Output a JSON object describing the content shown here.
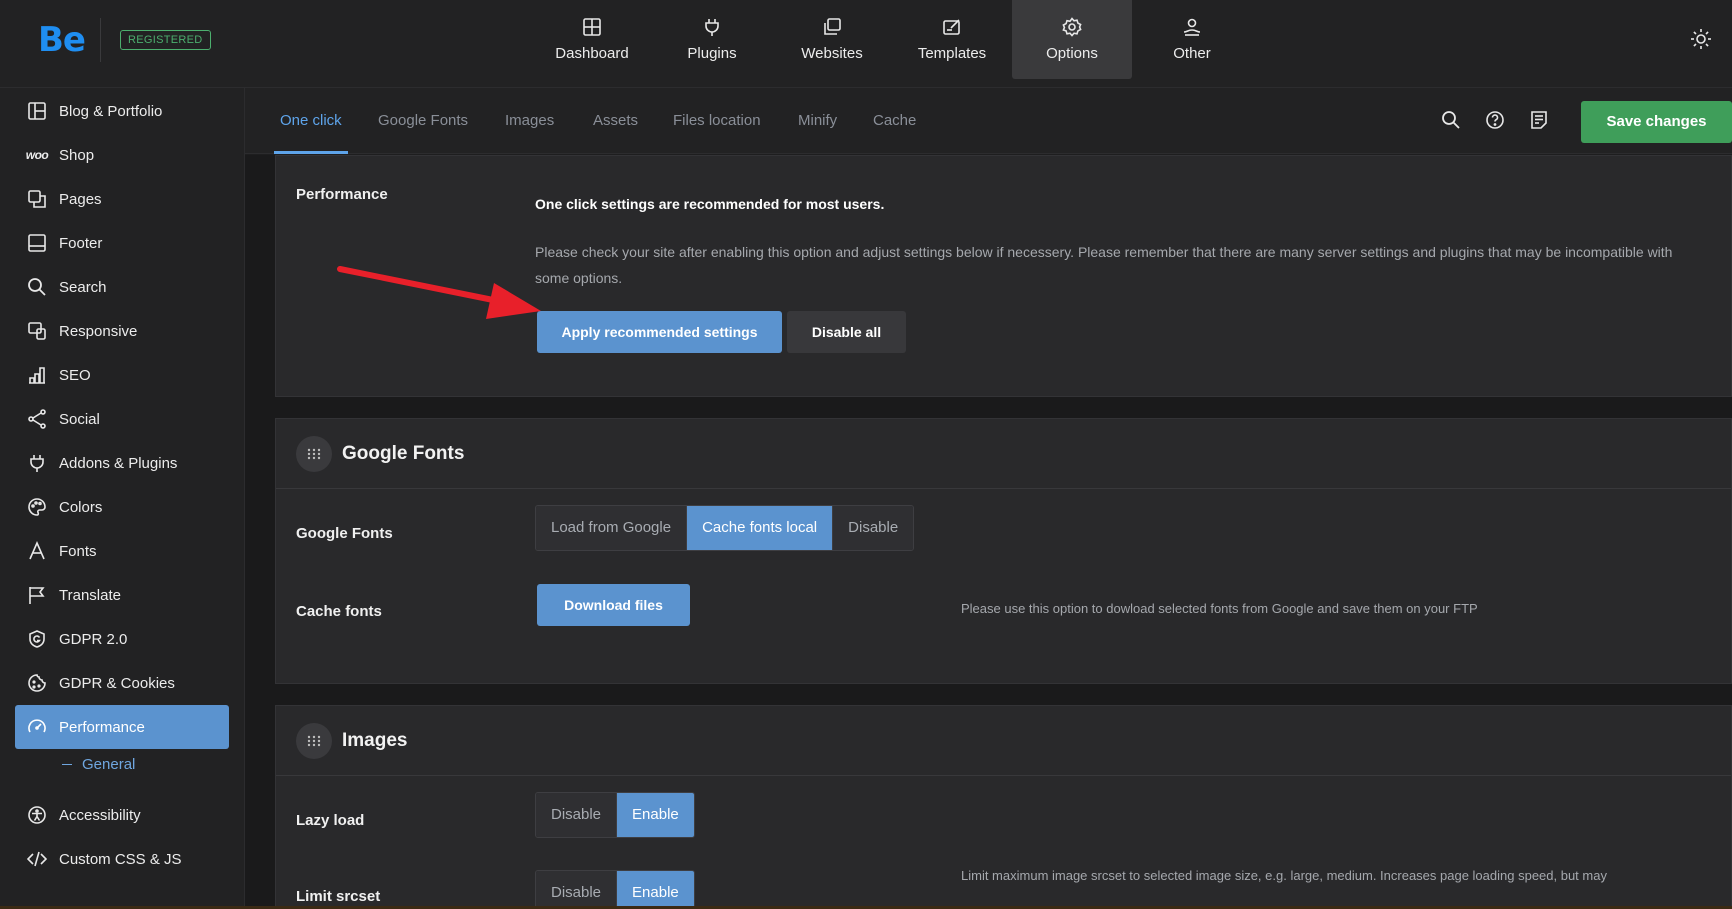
{
  "brand": {
    "logo": "Be",
    "badge": "REGISTERED"
  },
  "topnav": [
    {
      "label": "Dashboard",
      "icon": "dashboard-icon"
    },
    {
      "label": "Plugins",
      "icon": "plug-icon"
    },
    {
      "label": "Websites",
      "icon": "websites-icon"
    },
    {
      "label": "Templates",
      "icon": "templates-icon"
    },
    {
      "label": "Options",
      "icon": "gear-icon",
      "active": true
    },
    {
      "label": "Other",
      "icon": "user-hand-icon"
    }
  ],
  "sidebar": {
    "items": [
      {
        "label": "Blog & Portfolio",
        "icon": "layout-icon"
      },
      {
        "label": "Shop",
        "icon": "woo-icon",
        "icon_text": "woo"
      },
      {
        "label": "Pages",
        "icon": "pages-icon"
      },
      {
        "label": "Footer",
        "icon": "footer-icon"
      },
      {
        "label": "Search",
        "icon": "search-icon"
      },
      {
        "label": "Responsive",
        "icon": "responsive-icon"
      },
      {
        "label": "SEO",
        "icon": "seo-icon"
      },
      {
        "label": "Social",
        "icon": "share-icon"
      },
      {
        "label": "Addons & Plugins",
        "icon": "plug-icon"
      },
      {
        "label": "Colors",
        "icon": "palette-icon"
      },
      {
        "label": "Fonts",
        "icon": "font-icon"
      },
      {
        "label": "Translate",
        "icon": "flag-icon"
      },
      {
        "label": "GDPR 2.0",
        "icon": "shield-icon"
      },
      {
        "label": "GDPR & Cookies",
        "icon": "cookie-icon"
      },
      {
        "label": "Performance",
        "icon": "speedometer-icon",
        "active": true
      },
      {
        "label": "Accessibility",
        "icon": "accessibility-icon"
      },
      {
        "label": "Custom CSS & JS",
        "icon": "code-icon"
      }
    ],
    "sub_item": "General"
  },
  "tabs": [
    "One click",
    "Google Fonts",
    "Images",
    "Assets",
    "Files location",
    "Minify",
    "Cache"
  ],
  "toolbar": {
    "save_label": "Save changes"
  },
  "performance": {
    "label": "Performance",
    "heading": "One click settings are recommended for most users.",
    "description": "Please check your site after enabling this option and adjust settings below if necessery. Please remember that there are many server settings and plugins that may be incompatible with some options.",
    "apply_label": "Apply recommended settings",
    "disable_label": "Disable all"
  },
  "google_fonts": {
    "title": "Google Fonts",
    "row1_label": "Google Fonts",
    "options": [
      "Load from Google",
      "Cache fonts local",
      "Disable"
    ],
    "selected": "Cache fonts local",
    "row2_label": "Cache fonts",
    "download_label": "Download files",
    "cache_desc": "Please use this option to dowload selected fonts from Google and save them on your FTP"
  },
  "images": {
    "title": "Images",
    "row1_label": "Lazy load",
    "lazy_options": [
      "Disable",
      "Enable"
    ],
    "lazy_selected": "Enable",
    "row2_label": "Limit srcset",
    "srcset_options": [
      "Disable",
      "Enable"
    ],
    "srcset_desc": "Limit maximum image srcset to selected image size, e.g. large, medium. Increases page loading speed, but may"
  },
  "colors": {
    "accent": "#5b93cf",
    "save": "#3f9e5a",
    "tab_active": "#5ea4ea",
    "arrow": "#e8202a"
  }
}
